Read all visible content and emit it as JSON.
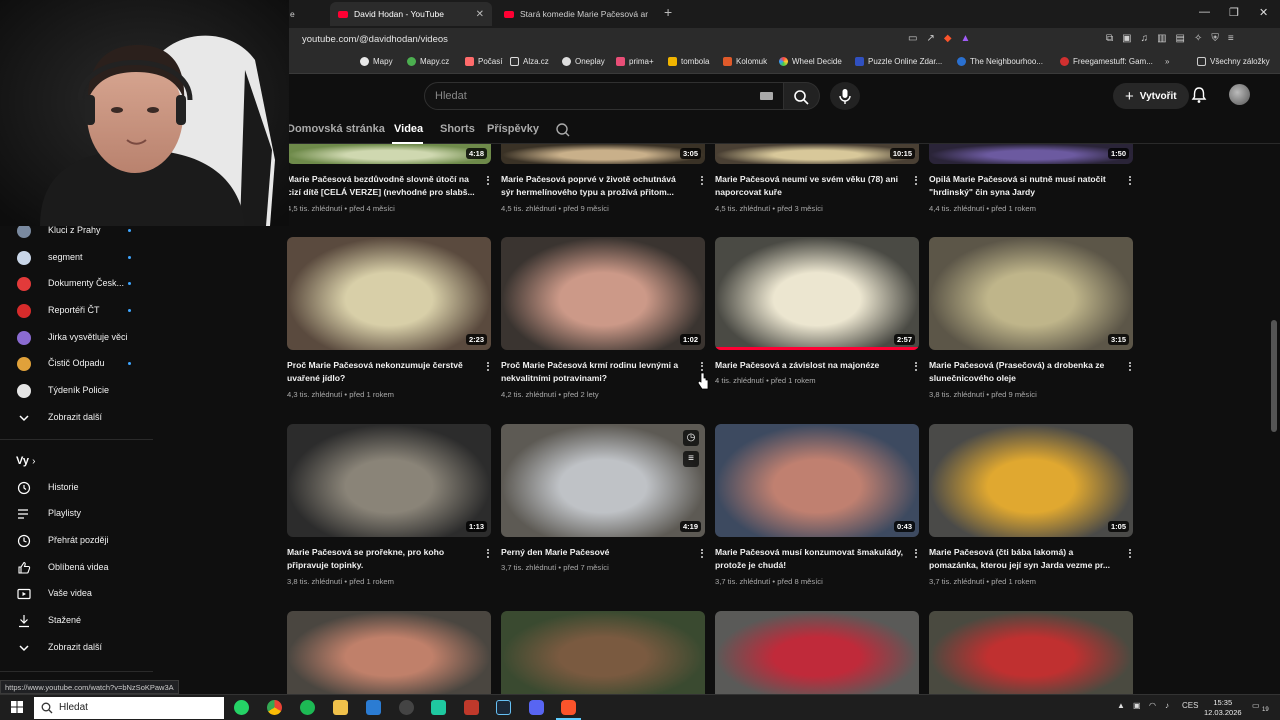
{
  "browser": {
    "tabs": [
      {
        "title": "David Hodan - YouTube",
        "active": true
      },
      {
        "title": "Stará komedie Marie Pačesová aneb",
        "active": false
      }
    ],
    "tab_prefix": "e",
    "url": "youtube.com/@davidhodan/videos",
    "bookmarks": [
      "Mapy",
      "Mapy.cz",
      "Počasí",
      "Alza.cz",
      "Oneplay",
      "prima+",
      "tombola",
      "Kolomuk",
      "Wheel Decide",
      "Puzzle Online Zdar...",
      "The Neighbourhoo...",
      "Freegamestuff: Gam...",
      "Všechny záložky"
    ],
    "status_url": "https://www.youtube.com/watch?v=bNzSoKPaw3A"
  },
  "youtube": {
    "search_placeholder": "Hledat",
    "create_label": "Vytvořit",
    "channel_tabs": [
      "Domovská stránka",
      "Videa",
      "Shorts",
      "Příspěvky"
    ],
    "active_tab": "Videa"
  },
  "sidebar": {
    "subscriptions": [
      {
        "label": "Kluci z Prahy",
        "color": "#7a8aa0"
      },
      {
        "label": "segment",
        "color": "#c9d6e8"
      },
      {
        "label": "Dokumenty Česk...",
        "color": "#e23a3a"
      },
      {
        "label": "Reportéři ČT",
        "color": "#d62b2b"
      },
      {
        "label": "Jirka vysvětluje věci",
        "color": "#8a6bd1"
      },
      {
        "label": "Čistič Odpadu",
        "color": "#e0a13a"
      },
      {
        "label": "Týdeník Policie",
        "color": "#e5e5e5"
      }
    ],
    "show_more_1": "Zobrazit další",
    "you_heading": "Vy",
    "you_items": [
      {
        "label": "Historie",
        "icon": "history-icon"
      },
      {
        "label": "Playlisty",
        "icon": "playlists-icon"
      },
      {
        "label": "Přehrát později",
        "icon": "watch-later-icon"
      },
      {
        "label": "Oblíbená videa",
        "icon": "liked-videos-icon"
      },
      {
        "label": "Vaše videa",
        "icon": "your-videos-icon"
      },
      {
        "label": "Stažené",
        "icon": "downloads-icon"
      }
    ],
    "show_more_2": "Zobrazit další"
  },
  "videos": [
    {
      "title": "Marie Pačesová bezdůvodně slovně útočí na cizí dítě [CELÁ VERZE] (nevhodné pro slabš...",
      "views": "4,5 tis. zhlédnutí",
      "age": "před 4 měsíci",
      "duration": "4:18"
    },
    {
      "title": "Marie Pačesová poprvé v životě ochutnává sýr hermelínového typu a prožívá přitom...",
      "views": "4,5 tis. zhlédnutí",
      "age": "před 9 měsíci",
      "duration": "3:05"
    },
    {
      "title": "Marie Pačesová neumí ve svém věku (78) ani naporcovat kuře",
      "views": "4,5 tis. zhlédnutí",
      "age": "před 3 měsíci",
      "duration": "10:15"
    },
    {
      "title": "Opilá Marie Pačesová si nutně musí natočit \"hrdinský\" čin syna Jardy",
      "views": "4,4 tis. zhlédnutí",
      "age": "před 1 rokem",
      "duration": "1:50"
    },
    {
      "title": "Proč Marie Pačesová nekonzumuje čerstvě uvařené jídlo?",
      "views": "4,3 tis. zhlédnutí",
      "age": "před 1 rokem",
      "duration": "2:23"
    },
    {
      "title": "Proč Marie Pačesová krmí rodinu levnými a nekvalitními potravinami?",
      "views": "4,2 tis. zhlédnutí",
      "age": "před 2 lety",
      "duration": "1:02"
    },
    {
      "title": "Marie Pačesová a závislost na majonéze",
      "views": "4 tis. zhlédnutí",
      "age": "před 1 rokem",
      "duration": "2:57",
      "watched_fraction": 1.0
    },
    {
      "title": "Marie Pačesová (Prasečová) a drobenka ze slunečnicového oleje",
      "views": "3,8 tis. zhlédnutí",
      "age": "před 9 měsíci",
      "duration": "3:15"
    },
    {
      "title": "Marie Pačesová se prořekne, pro koho připravuje topinky.",
      "views": "3,8 tis. zhlédnutí",
      "age": "před 1 rokem",
      "duration": "1:13"
    },
    {
      "title": "Perný den Marie Pačesové",
      "views": "3,7 tis. zhlédnutí",
      "age": "před 7 měsíci",
      "duration": "4:19"
    },
    {
      "title": "Marie Pačesová musí konzumovat šmakulády, protože je chudá!",
      "views": "3,7 tis. zhlédnutí",
      "age": "před 8 měsíci",
      "duration": "0:43"
    },
    {
      "title": "Marie Pačesová (čti bába lakomá) a pomazánka, kterou její syn Jarda vezme pr...",
      "views": "3,7 tis. zhlédnutí",
      "age": "před 1 rokem",
      "duration": "1:05"
    }
  ],
  "taskbar": {
    "search": "Hledat",
    "lang": "CES",
    "time": "15:35",
    "date": "12.03.2026",
    "notif_count": "19"
  }
}
